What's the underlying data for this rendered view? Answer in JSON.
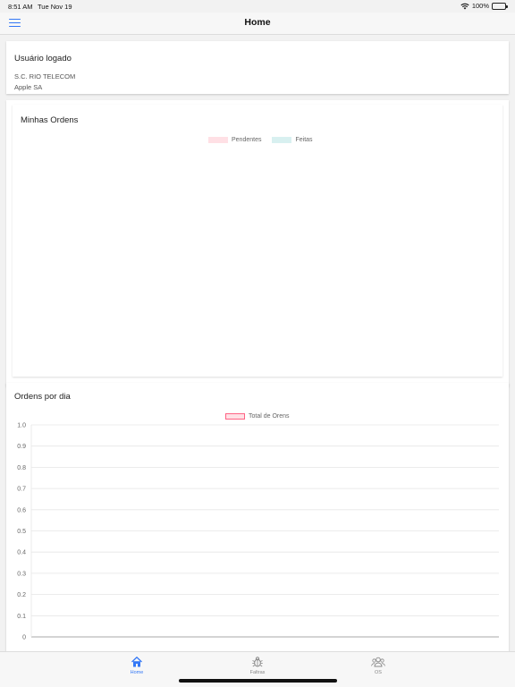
{
  "status_bar": {
    "time": "8:51 AM",
    "date": "Tue Nov 19",
    "battery": "100%"
  },
  "nav": {
    "title": "Home",
    "menu_icon": "hamburger-menu-icon"
  },
  "user_card": {
    "title": "Usuário logado",
    "company": "S.C. RIO TELECOM",
    "device": "Apple SA"
  },
  "orders_card": {
    "title": "Minhas Ordens",
    "legend": [
      "Pendentes",
      "Feitas"
    ],
    "colors": {
      "pendentes": "#ffe0e5",
      "feitas": "#d8f0f0"
    }
  },
  "daily_card": {
    "title": "Ordens por dia",
    "chart_data": {
      "type": "line",
      "title": "",
      "series": [
        {
          "name": "Total de Orens",
          "values": []
        }
      ],
      "y_ticks": [
        "1.0",
        "0.9",
        "0.8",
        "0.7",
        "0.6",
        "0.5",
        "0.4",
        "0.3",
        "0.2",
        "0.1",
        "0"
      ],
      "ylim": [
        0,
        1.0
      ],
      "grid": true,
      "legend_position": "top-center",
      "colors": {
        "fill": "#ffe0e5",
        "border": "#ff6384"
      }
    }
  },
  "tabs": [
    {
      "label": "Home",
      "icon": "house-icon",
      "active": true
    },
    {
      "label": "Faltras",
      "icon": "bug-icon",
      "active": false
    },
    {
      "label": "OS",
      "icon": "people-icon",
      "active": false
    }
  ],
  "accent_color": "#3478f6"
}
